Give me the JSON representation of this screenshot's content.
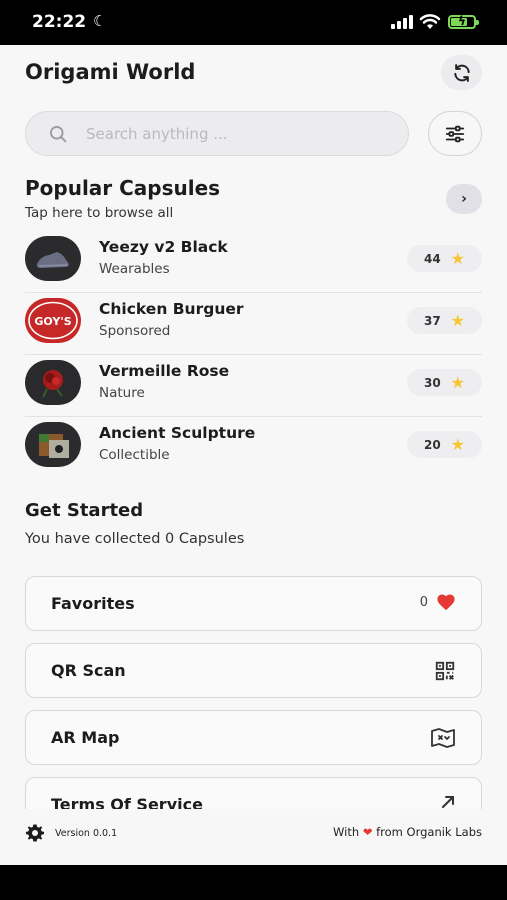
{
  "status_bar": {
    "time": "22:22"
  },
  "header": {
    "title": "Origami World"
  },
  "search": {
    "placeholder": "Search anything ..."
  },
  "popular": {
    "title": "Popular Capsules",
    "subtitle": "Tap here to browse all",
    "items": [
      {
        "name": "Yeezy v2 Black",
        "category": "Wearables",
        "rating": "44",
        "thumb": "sneaker"
      },
      {
        "name": "Chicken Burguer",
        "category": "Sponsored",
        "rating": "37",
        "thumb": "goys-logo",
        "logo_text": "GOY'S"
      },
      {
        "name": "Vermeille Rose",
        "category": "Nature",
        "rating": "30",
        "thumb": "rose"
      },
      {
        "name": "Ancient Sculpture",
        "category": "Collectible",
        "rating": "20",
        "thumb": "sculpture"
      }
    ]
  },
  "get_started": {
    "title": "Get Started",
    "subtitle": "You have collected 0 Capsules"
  },
  "menu": {
    "favorites": {
      "label": "Favorites",
      "count": "0",
      "icon": "heart-icon"
    },
    "qr_scan": {
      "label": "QR Scan",
      "icon": "qr-code-icon"
    },
    "ar_map": {
      "label": "AR Map",
      "icon": "map-icon"
    },
    "terms": {
      "label": "Terms Of Service",
      "icon": "external-arrow-icon"
    }
  },
  "footer": {
    "version": "Version 0.0.1",
    "credit_prefix": "With",
    "credit_suffix": "from Organik Labs"
  },
  "colors": {
    "background": "#f7f7f8",
    "star": "#f6c534",
    "heart": "#e53935",
    "battery": "#7ed957"
  }
}
